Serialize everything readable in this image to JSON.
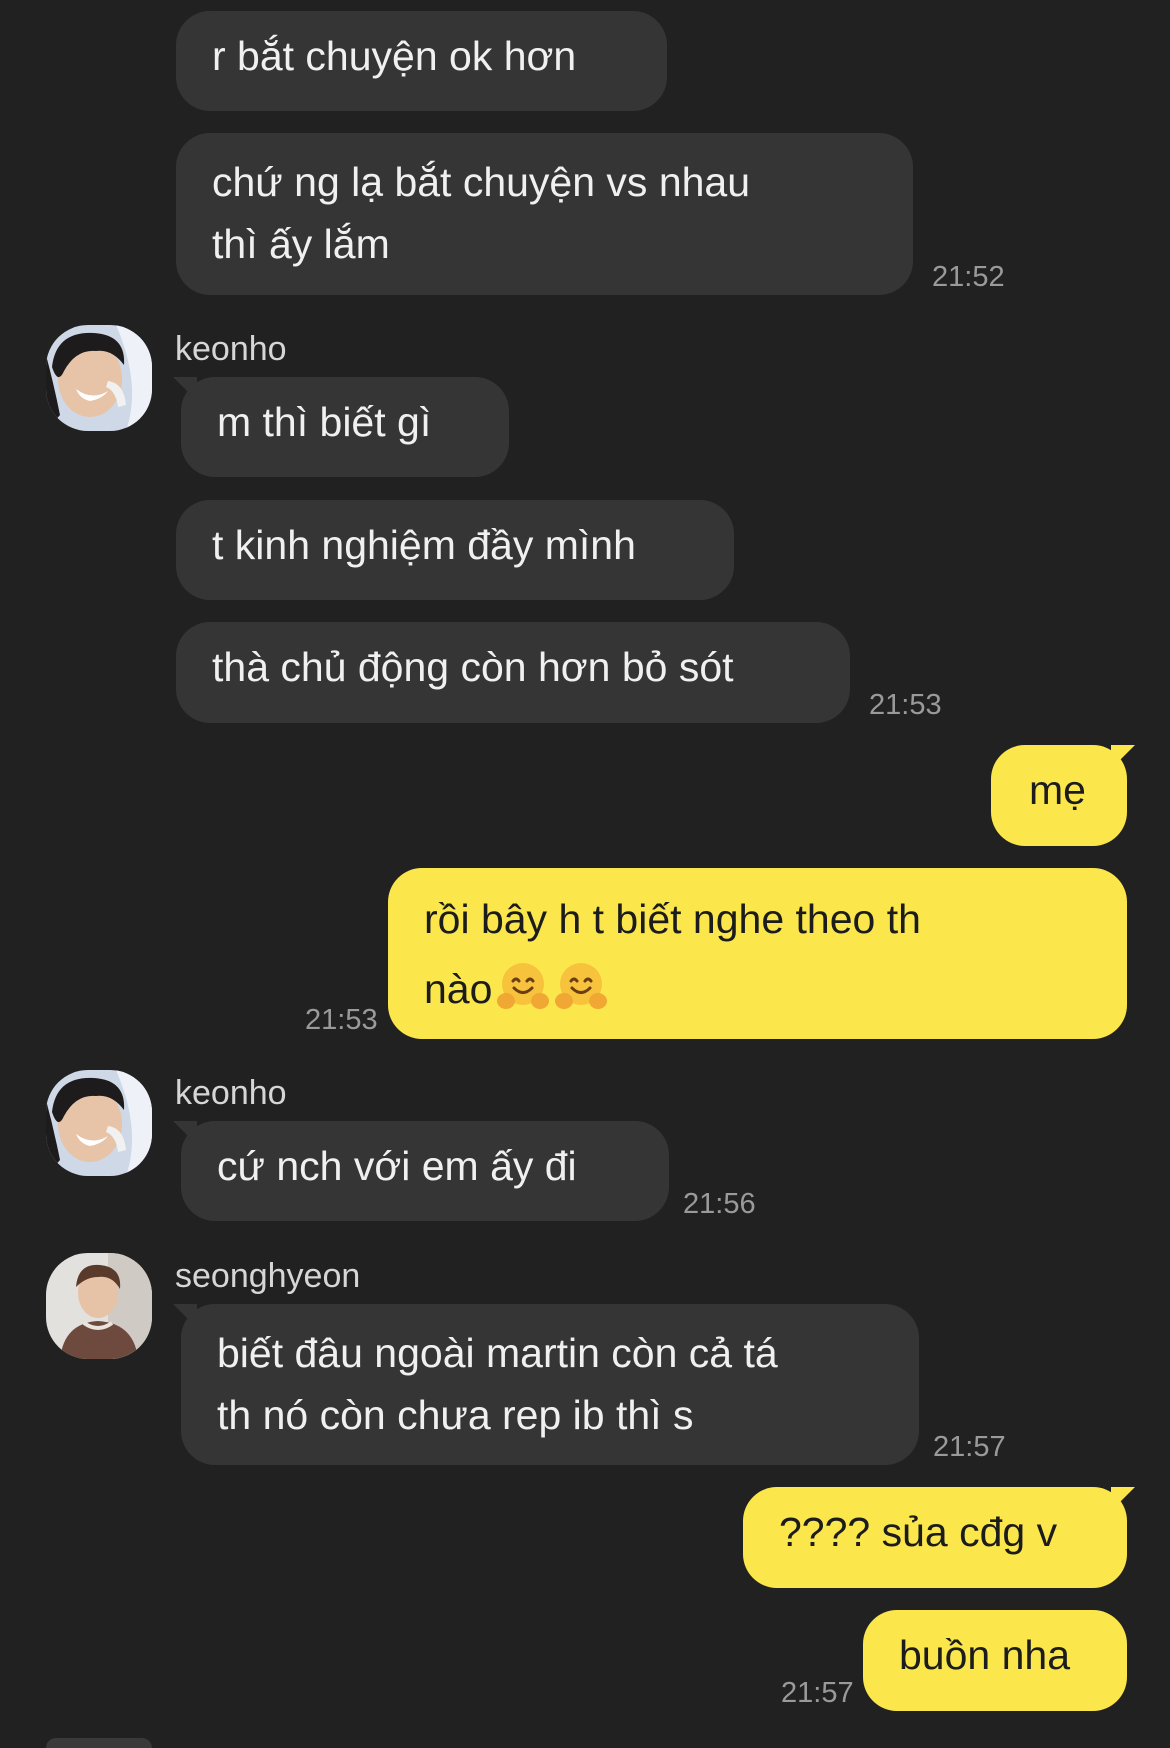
{
  "messages": [
    {
      "text": "r bắt chuyện ok hơn"
    },
    {
      "line1": "chứ ng lạ bắt chuyện vs nhau",
      "line2": "thì ấy lắm",
      "time": "21:52"
    },
    {
      "sender": "keonho",
      "text": "m thì biết gì"
    },
    {
      "text": "t kinh nghiệm đầy mình"
    },
    {
      "text": "thà chủ động còn hơn bỏ sót",
      "time": "21:53"
    },
    {
      "text": "mẹ"
    },
    {
      "line1": "rồi bây h t biết nghe theo th",
      "line2": "nào",
      "emoji": "hugging-face-emoji",
      "time": "21:53"
    },
    {
      "sender": "keonho",
      "text": "cứ nch với em ấy đi",
      "time": "21:56"
    },
    {
      "sender": "seonghyeon",
      "line1": "biết đâu ngoài martin còn cả tá",
      "line2": "th nó còn chưa rep ib thì s",
      "time": "21:57"
    },
    {
      "text": "???? sủa cđg v"
    },
    {
      "text": "buồn nha",
      "time": "21:57"
    }
  ],
  "colors": {
    "background": "#212121",
    "incoming_bubble": "#353535",
    "outgoing_bubble": "#fbe74c",
    "timestamp": "#9a9a9a"
  }
}
